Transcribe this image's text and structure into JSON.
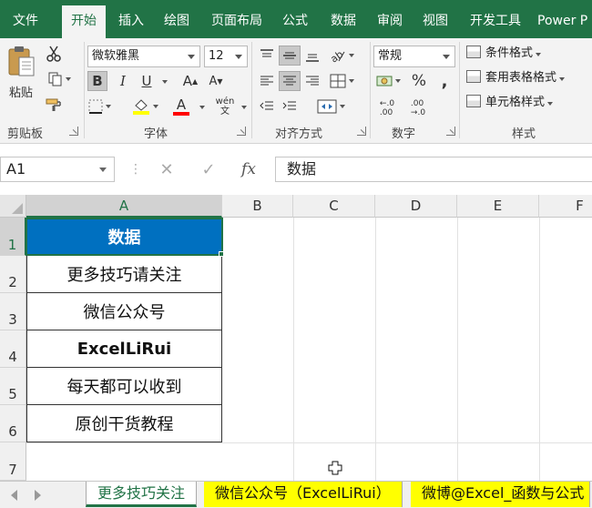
{
  "ribbon_tabs": [
    "文件",
    "开始",
    "插入",
    "绘图",
    "页面布局",
    "公式",
    "数据",
    "审阅",
    "视图",
    "开发工具",
    "Power P"
  ],
  "active_tab": "开始",
  "clipboard": {
    "paste_label": "粘贴",
    "group_label": "剪贴板"
  },
  "font": {
    "name": "微软雅黑",
    "size": "12",
    "group_label": "字体",
    "bold": "B",
    "italic": "I",
    "underline": "U",
    "grow": "A",
    "shrink": "A",
    "phonetic": "wén",
    "font_color_glyph": "A",
    "fill_color": "#ffff00",
    "font_color": "#ff0000"
  },
  "alignment": {
    "group_label": "对齐方式"
  },
  "number": {
    "format": "常规",
    "group_label": "数字",
    "percent": "%",
    "comma": ",",
    "inc_decimal": "←.0\n.00",
    "dec_decimal": ".00\n→.0"
  },
  "styles": {
    "group_label": "样式",
    "conditional": "条件格式",
    "table": "套用表格格式",
    "cell": "单元格样式"
  },
  "formula_bar": {
    "name_box": "A1",
    "cancel": "✕",
    "enter": "✓",
    "fx": "fx",
    "value": "数据"
  },
  "columns": [
    "A",
    "B",
    "C",
    "D",
    "E",
    "F"
  ],
  "rows": [
    "1",
    "2",
    "3",
    "4",
    "5",
    "6",
    "7"
  ],
  "cells": [
    "数据",
    "更多技巧请关注",
    "微信公众号",
    "ExcelLiRui",
    "每天都可以收到",
    "原创干货教程"
  ],
  "sheet_tabs": [
    "更多技巧关注",
    "微信公众号（ExcelLiRui）",
    "微博@Excel_函数与公式"
  ],
  "colors": {
    "brand": "#217346",
    "header_fill": "#0070c0",
    "tab_highlight": "#ffff00"
  }
}
